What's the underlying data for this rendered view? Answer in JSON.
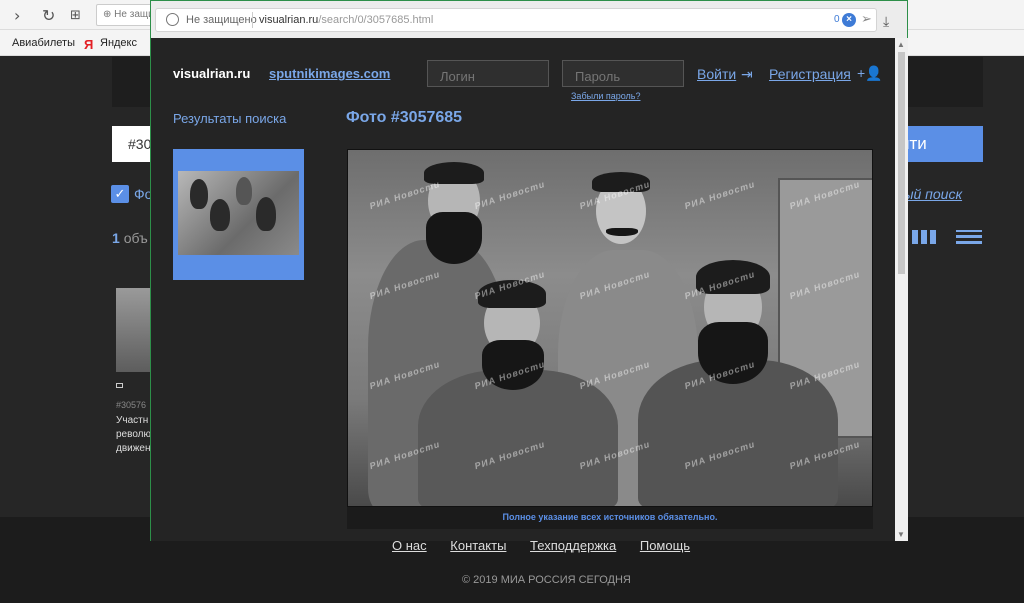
{
  "background": {
    "url_fragment": "Не защищ",
    "bookmarks": [
      "Авиабилеты",
      "Яндекс"
    ],
    "yandex_letter": "Я",
    "search_value": "#30",
    "search_button": "йти",
    "checkbox_label": "Фо",
    "advanced_search": "енный поиск",
    "result_count": "1",
    "result_count_suffix": "объ",
    "card_id": "#30576",
    "card_text": "Участн революц движен",
    "footer_links": [
      "О нас",
      "Контакты",
      "Техподдержка",
      "Помощь"
    ],
    "copyright": "© 2019 МИА РОССИЯ СЕГОДНЯ"
  },
  "popup": {
    "security": "Не защищено",
    "url_host": "visualrian.ru",
    "url_path": "/search/0/3057685.html",
    "counter": "0",
    "site_logo": "visualrian.ru",
    "partner_link": "sputnikimages.com",
    "login_placeholder": "Логин",
    "password_placeholder": "Пароль",
    "forgot_password": "Забыли пароль?",
    "login_link": "Войти",
    "register_link": "Регистрация",
    "results_title": "Результаты поиска",
    "photo_title": "Фото #3057685",
    "watermark": "РИА Новости",
    "caption": "Полное указание всех источников обязательно."
  },
  "colors": {
    "accent": "#5b8fe6",
    "link": "#7aa7e8",
    "page_bg": "#242424",
    "popup_border": "#2d8f49"
  }
}
